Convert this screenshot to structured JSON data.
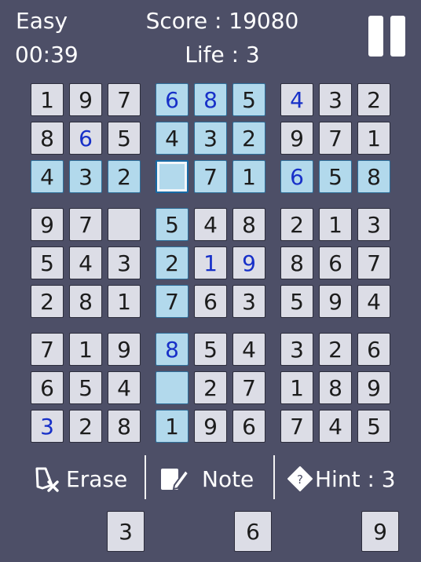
{
  "hud": {
    "difficulty": "Easy",
    "timer": "00:39",
    "score": "Score : 19080",
    "life": "Life : 3"
  },
  "board": [
    [
      "1",
      "9",
      "7",
      "6",
      "8",
      "5",
      "4",
      "3",
      "2"
    ],
    [
      "8",
      "6",
      "5",
      "4",
      "3",
      "2",
      "9",
      "7",
      "1"
    ],
    [
      "4",
      "3",
      "2",
      "",
      "7",
      "1",
      "6",
      "5",
      "8"
    ],
    [
      "9",
      "7",
      "",
      "5",
      "4",
      "8",
      "2",
      "1",
      "3"
    ],
    [
      "5",
      "4",
      "3",
      "2",
      "1",
      "9",
      "8",
      "6",
      "7"
    ],
    [
      "2",
      "8",
      "1",
      "7",
      "6",
      "3",
      "5",
      "9",
      "4"
    ],
    [
      "7",
      "1",
      "9",
      "8",
      "5",
      "4",
      "3",
      "2",
      "6"
    ],
    [
      "6",
      "5",
      "4",
      "",
      "2",
      "7",
      "1",
      "8",
      "9"
    ],
    [
      "3",
      "2",
      "8",
      "1",
      "9",
      "6",
      "7",
      "4",
      "5"
    ]
  ],
  "user_entered": [
    [
      0,
      3
    ],
    [
      0,
      4
    ],
    [
      0,
      6
    ],
    [
      1,
      1
    ],
    [
      2,
      6
    ],
    [
      4,
      4
    ],
    [
      4,
      5
    ],
    [
      6,
      3
    ],
    [
      8,
      0
    ]
  ],
  "highlighted": [
    [
      0,
      3
    ],
    [
      0,
      4
    ],
    [
      0,
      5
    ],
    [
      1,
      3
    ],
    [
      1,
      4
    ],
    [
      1,
      5
    ],
    [
      2,
      0
    ],
    [
      2,
      1
    ],
    [
      2,
      2
    ],
    [
      2,
      4
    ],
    [
      2,
      5
    ],
    [
      2,
      6
    ],
    [
      2,
      7
    ],
    [
      2,
      8
    ],
    [
      3,
      3
    ],
    [
      4,
      3
    ],
    [
      5,
      3
    ],
    [
      6,
      3
    ],
    [
      7,
      3
    ],
    [
      8,
      3
    ]
  ],
  "selected": [
    2,
    3
  ],
  "toolbar": {
    "erase": "Erase",
    "note": "Note",
    "hint": "Hint : 3"
  },
  "number_pad": [
    "3",
    "6",
    "9"
  ],
  "colors": {
    "background": "#4d4f67",
    "cell": "#dcdde6",
    "highlight": "#b2d9ec",
    "user_digit": "#1730c8"
  },
  "icons": {
    "pause": "pause-icon",
    "erase": "eraser-icon",
    "note": "pencil-note-icon",
    "hint": "hint-diamond-icon"
  }
}
